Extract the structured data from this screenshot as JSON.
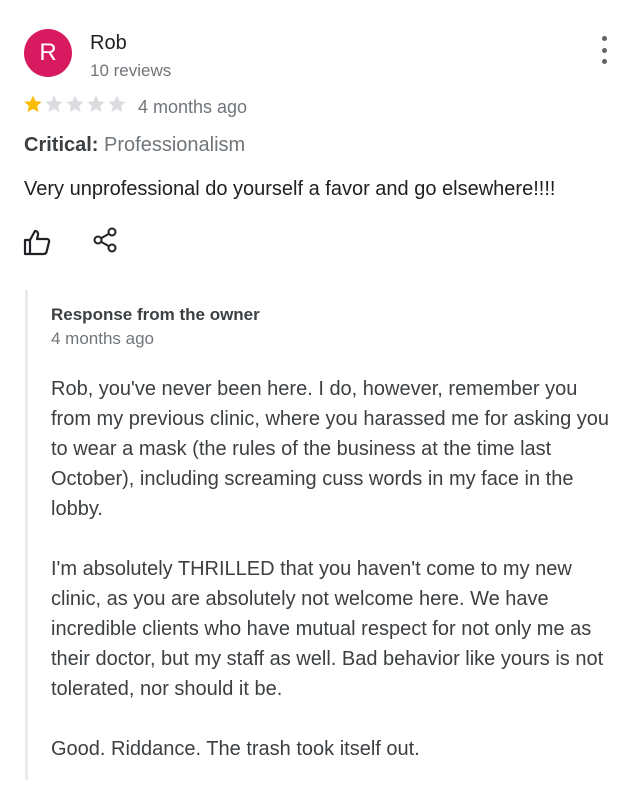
{
  "review": {
    "avatar_letter": "R",
    "avatar_color": "#d81b60",
    "reviewer_name": "Rob",
    "review_count": "10 reviews",
    "rating": 1,
    "rating_max": 5,
    "star_filled_color": "#fbbc04",
    "star_empty_color": "#dadce0",
    "date": "4 months ago",
    "critical_label": "Critical:",
    "critical_value": "Professionalism",
    "text": "Very unprofessional do yourself a favor and go elsewhere!!!!",
    "icons": {
      "more": "more-vert-icon",
      "like": "thumbs-up-icon",
      "share": "share-icon"
    }
  },
  "owner_response": {
    "title": "Response from the owner",
    "date": "4 months ago",
    "paragraphs": [
      "Rob, you've never been here. I do, however, remember you from my previous clinic, where you harassed me for asking you to wear a mask (the rules of the business at the time last October), including screaming cuss words in my face in the lobby.",
      "I'm absolutely THRILLED that you haven't come to my new clinic, as you are absolutely not welcome here. We have incredible clients who have mutual respect for not only me as their doctor, but my staff as well. Bad behavior like yours is not tolerated, nor should it be.",
      "Good. Riddance. The trash took itself out."
    ]
  }
}
